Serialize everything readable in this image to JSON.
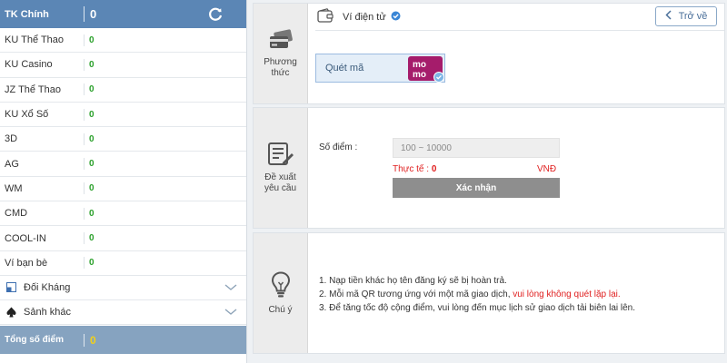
{
  "sidebar": {
    "header": {
      "label": "TK Chính",
      "value": "0"
    },
    "rows": [
      {
        "label": "KU Thể Thao",
        "value": "0"
      },
      {
        "label": "KU Casino",
        "value": "0"
      },
      {
        "label": "JZ Thể Thao",
        "value": "0"
      },
      {
        "label": "KU Xổ Số",
        "value": "0"
      },
      {
        "label": "3D",
        "value": "0"
      },
      {
        "label": "AG",
        "value": "0"
      },
      {
        "label": "WM",
        "value": "0"
      },
      {
        "label": "CMD",
        "value": "0"
      },
      {
        "label": "COOL-IN",
        "value": "0"
      },
      {
        "label": "Ví bạn bè",
        "value": "0"
      }
    ],
    "collapsibles": [
      {
        "label": "Đối Kháng",
        "icon": "duel-icon"
      },
      {
        "label": "Sảnh khác",
        "icon": "spade-icon"
      }
    ],
    "total": {
      "label": "Tổng số điểm",
      "value": "0"
    }
  },
  "method_panel": {
    "side_label_1": "Phương",
    "side_label_2": "thức",
    "wallet_title": "Ví điện tử",
    "back_label": "Trở về",
    "method_label": "Quét mã",
    "brand_text": "mo mo"
  },
  "request_panel": {
    "side_label_1": "Đề xuất",
    "side_label_2": "yêu cầu",
    "points_label": "Số điểm :",
    "points_placeholder": "100 ~ 10000",
    "actual_label": "Thực tế :",
    "actual_value": "0",
    "currency": "VNĐ",
    "confirm_label": "Xác nhận"
  },
  "notes_panel": {
    "side_label": "Chú ý",
    "note1": "1.  Nạp tiền khác họ tên đăng ký sẽ bị hoàn trả.",
    "note2_prefix": "2.  Mỗi mã QR tương ứng với một mã giao dịch, ",
    "note2_red": "vui lòng không quét lặp lại.",
    "note3": "3.  Để tăng tốc độ cộng điểm, vui lòng đến mục lịch sử giao dịch tải biên lai lên."
  },
  "colors": {
    "header_blue": "#5b86b5",
    "total_bar": "#86a3c0",
    "value_green": "#2aa02a",
    "warn_red": "#e02020",
    "momo_pink": "#a51c6b"
  }
}
